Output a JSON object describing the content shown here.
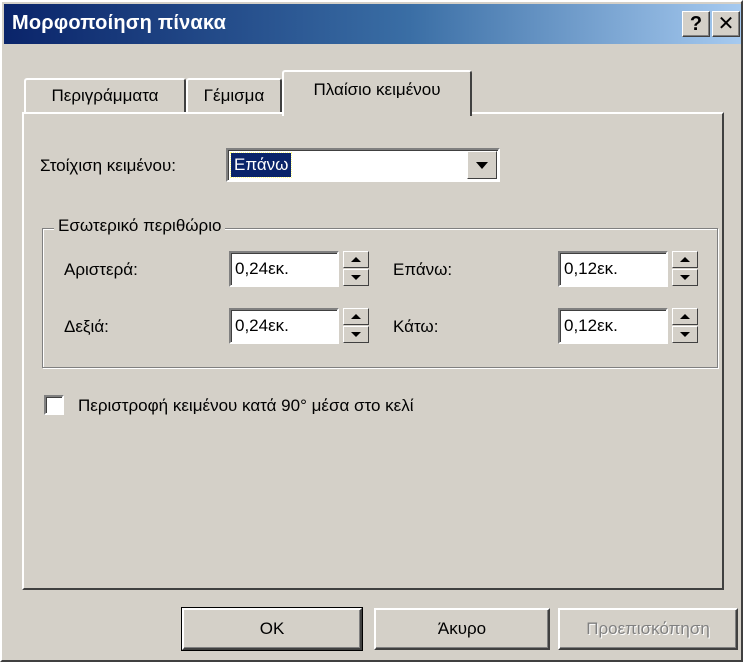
{
  "window": {
    "title": "Μορφοποίηση πίνακα",
    "help_label": "?",
    "close_label": "✕"
  },
  "tabs": [
    {
      "label": "Περιγράμματα"
    },
    {
      "label": "Γέμισμα"
    },
    {
      "label": "Πλαίσιο κειμένου",
      "active": true
    }
  ],
  "alignment": {
    "label": "Στοίχιση κειμένου:",
    "value": "Επάνω"
  },
  "margins": {
    "group_label": "Εσωτερικό περιθώριο",
    "left": {
      "label": "Αριστερά:",
      "value": "0,24εκ."
    },
    "right": {
      "label": "Δεξιά:",
      "value": "0,24εκ."
    },
    "top": {
      "label": "Επάνω:",
      "value": "0,12εκ."
    },
    "bottom": {
      "label": "Κάτω:",
      "value": "0,12εκ."
    }
  },
  "rotate": {
    "label": "Περιστροφή κειμένου κατά 90° μέσα στο κελί",
    "checked": false
  },
  "buttons": {
    "ok": "OK",
    "cancel": "Άκυρο",
    "preview": "Προεπισκόπηση"
  },
  "colors": {
    "titlebar_start": "#0a246a",
    "dialog_bg": "#d4d0c8",
    "selection": "#0a246a"
  }
}
